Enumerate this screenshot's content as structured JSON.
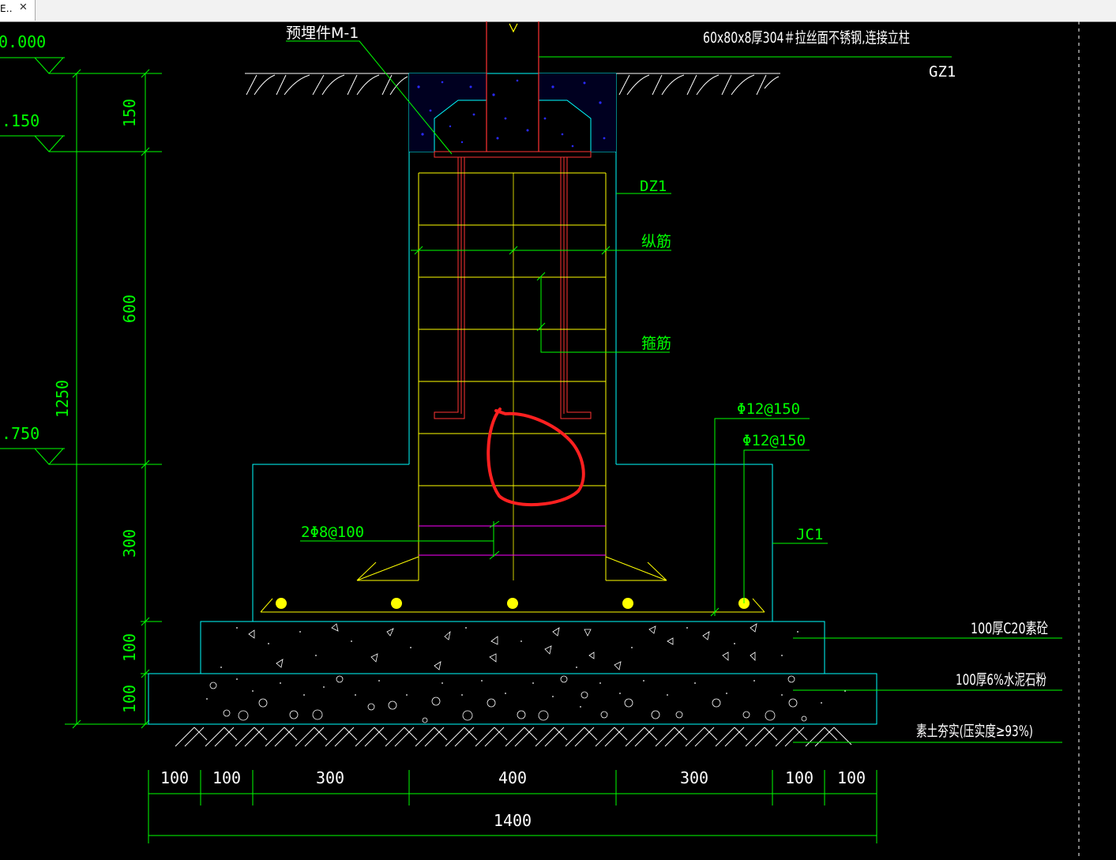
{
  "window": {
    "tab_label": "E‥",
    "close_glyph": "✕",
    "close_icon": "close-icon"
  },
  "colors": {
    "background": "#000000",
    "tabbar": "#f2f2f2",
    "green": "#00ff00",
    "cyan": "#00ffff",
    "yellow": "#ffff00",
    "red": "#ff3333",
    "white": "#ffffff",
    "magenta": "#ff00ff",
    "blue": "#2020ff",
    "highlight": "#ff2020"
  },
  "labels": {
    "embed": "预埋件M-1",
    "steel": "60x80x8厚304＃拉丝面不锈钢,连接立柱",
    "gz1": "GZ1",
    "dz1": "DZ1",
    "zongjin": "纵筋",
    "gujin": "箍筋",
    "rebar1": "Φ12@150",
    "rebar2": "Φ12@150",
    "rebar3": "2Φ8@100",
    "jc1": "JC1",
    "c20": "100厚C20素砼",
    "cement": "100厚6%水泥石粉",
    "soil": "素土夯实(压实度≥93%)"
  },
  "elevations": {
    "e1": "0.000",
    "e2": ".150",
    "e3": ".750"
  },
  "dims_vertical": {
    "d150": "150",
    "d600": "600",
    "d300": "300",
    "d100a": "100",
    "d100b": "100",
    "d1250": "1250"
  },
  "dims_horizontal": {
    "h1": "100",
    "h2": "100",
    "h3": "300",
    "h4": "400",
    "h5": "300",
    "h6": "100",
    "h7": "100",
    "total": "1400"
  }
}
